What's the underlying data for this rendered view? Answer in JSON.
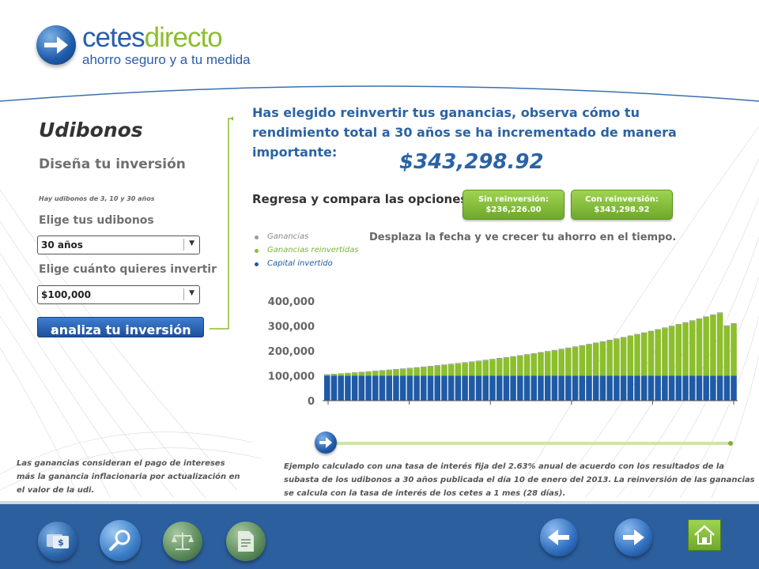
{
  "brand": {
    "name_part1": "cetes",
    "name_part2": "directo",
    "tagline": "ahorro seguro y a tu medida",
    "colors": {
      "blue": "#2a5ea8",
      "green": "#8cbe2d"
    }
  },
  "left_panel": {
    "title": "Udibonos",
    "subtitle": "Diseña tu inversión",
    "note": "Hay udibonos de 3, 10 y 30 años",
    "term_label": "Elige tus udibonos",
    "term_value": "30 años",
    "amount_label": "Elige cuánto quieres invertir",
    "amount_value": "$100,000",
    "analyze_button": "analiza tu inversión"
  },
  "result": {
    "headline": "Has elegido reinvertir tus ganancias, observa cómo tu rendimiento total a 30 años se ha incrementado de manera importante:",
    "total": "$343,298.92",
    "compare_label": "Regresa y compara las opciones",
    "option_no_reinvest": {
      "label": "Sin reinversión:",
      "value": "$236,226.00"
    },
    "option_reinvest": {
      "label": "Con reinversión:",
      "value": "$343,298.92"
    },
    "hint": "Desplaza la fecha y ve crecer tu ahorro en el tiempo."
  },
  "legend": [
    {
      "label": "Ganancias",
      "color": "#9a9a9a"
    },
    {
      "label": "Ganancias reinvertidas",
      "color": "#8cbe2d"
    },
    {
      "label": "Capital invertido",
      "color": "#1f5aa6"
    }
  ],
  "chart_data": {
    "type": "bar",
    "stacked": true,
    "ylim": [
      0,
      400000
    ],
    "y_ticks": [
      "0",
      "100,000",
      "200,000",
      "300,000",
      "400,000"
    ],
    "x": [
      1,
      2,
      3,
      4,
      5,
      6,
      7,
      8,
      9,
      10,
      11,
      12,
      13,
      14,
      15,
      16,
      17,
      18,
      19,
      20,
      21,
      22,
      23,
      24,
      25,
      26,
      27,
      28,
      29,
      30,
      31,
      32,
      33,
      34,
      35,
      36,
      37,
      38,
      39,
      40,
      41,
      42,
      43,
      44,
      45,
      46,
      47,
      48,
      49,
      50,
      51,
      52,
      53,
      54,
      55,
      56,
      57,
      58,
      59,
      60
    ],
    "series": [
      {
        "name": "Capital invertido",
        "color": "#1f5aa6",
        "values": [
          100000,
          100000,
          100000,
          100000,
          100000,
          100000,
          100000,
          100000,
          100000,
          100000,
          100000,
          100000,
          100000,
          100000,
          100000,
          100000,
          100000,
          100000,
          100000,
          100000,
          100000,
          100000,
          100000,
          100000,
          100000,
          100000,
          100000,
          100000,
          100000,
          100000,
          100000,
          100000,
          100000,
          100000,
          100000,
          100000,
          100000,
          100000,
          100000,
          100000,
          100000,
          100000,
          100000,
          100000,
          100000,
          100000,
          100000,
          100000,
          100000,
          100000,
          100000,
          100000,
          100000,
          100000,
          100000,
          100000,
          100000,
          100000,
          100000,
          100000
        ]
      },
      {
        "name": "Ganancias reinvertidas",
        "color": "#8cbe2d",
        "values": [
          3000,
          5000,
          6800,
          8800,
          10800,
          12900,
          15000,
          17200,
          19400,
          21700,
          24000,
          26400,
          28900,
          31400,
          34000,
          36700,
          39500,
          42300,
          45200,
          48200,
          51300,
          54500,
          57800,
          61200,
          64700,
          68300,
          72000,
          75800,
          79700,
          83700,
          87800,
          92000,
          96300,
          100800,
          105400,
          110100,
          115000,
          120000,
          125100,
          130400,
          135800,
          141300,
          147000,
          152800,
          158800,
          164900,
          171200,
          177600,
          184200,
          191000,
          197900,
          205000,
          212300,
          219800,
          227400,
          235200,
          243200,
          251400,
          199500,
          208000
        ]
      },
      {
        "name": "Ganancias",
        "color": "#9a9a9a",
        "values": [
          3000,
          3000,
          3000,
          3000,
          3000,
          3000,
          3000,
          3000,
          3000,
          3000,
          3000,
          3000,
          3000,
          3000,
          3000,
          3000,
          3000,
          3000,
          3000,
          3000,
          3000,
          3000,
          3000,
          3000,
          3000,
          3000,
          3000,
          3000,
          3000,
          3000,
          3000,
          3000,
          3000,
          3000,
          3000,
          3000,
          3000,
          3000,
          3000,
          3000,
          3000,
          3000,
          3000,
          3000,
          3000,
          3000,
          3000,
          3000,
          3000,
          3000,
          3000,
          3000,
          3000,
          3000,
          3000,
          3000,
          3000,
          3000,
          3000,
          3000
        ]
      }
    ]
  },
  "footnotes": {
    "left": "Las ganancias consideran el pago de intereses más la ganancia inflacionaria por actualización en el valor de la udi.",
    "right": "Ejemplo calculado con una tasa de interés fija del 2.63% anual de acuerdo con los resultados de la subasta de los udibonos a 30 años publicada el día 10 de enero del 2013. La reinversión de las ganancias se calcula con la tasa de interés de los cetes a 1 mes (28 días)."
  },
  "footer_icons": [
    "money-icon",
    "search-icon",
    "scale-icon",
    "document-icon",
    "back-arrow-icon",
    "forward-arrow-icon",
    "home-icon"
  ]
}
